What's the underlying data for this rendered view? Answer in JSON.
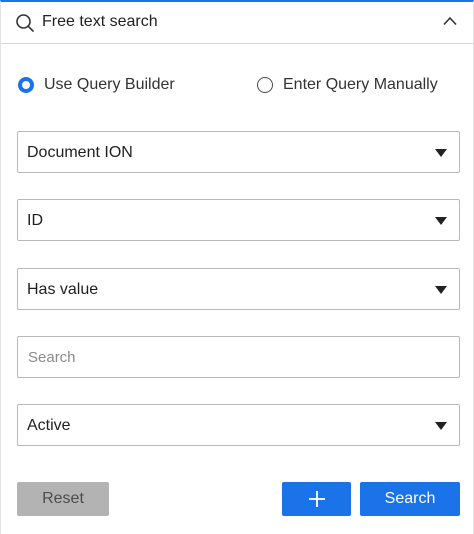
{
  "header": {
    "title": "Free text search",
    "icon": "search-icon",
    "toggle_icon": "chevron-up-icon"
  },
  "query_mode": {
    "options": [
      {
        "label": "Use Query Builder",
        "checked": true
      },
      {
        "label": "Enter Query Manually",
        "checked": false
      }
    ]
  },
  "builder": {
    "document_type": "Document ION",
    "attribute": "ID",
    "operator": "Has value",
    "search_placeholder": "Search",
    "search_value": "",
    "status": "Active"
  },
  "actions": {
    "reset_label": "Reset",
    "add_icon": "plus-icon",
    "search_label": "Search"
  },
  "colors": {
    "accent": "#1a73e8",
    "reset_button": "#b3b3b3",
    "border": "#b9b9b9"
  }
}
